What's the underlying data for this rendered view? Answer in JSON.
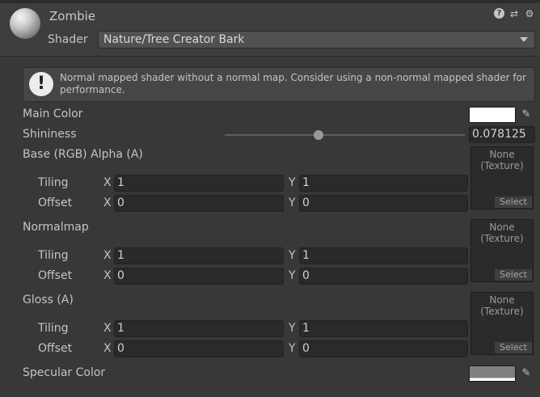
{
  "header": {
    "material_name": "Zombie",
    "shader_label": "Shader",
    "shader_value": "Nature/Tree Creator Bark",
    "icons": [
      "help-icon",
      "preset-icon",
      "settings-icon"
    ]
  },
  "warning": {
    "icon": "!",
    "text": "Normal mapped shader without a normal map. Consider using a non-normal mapped shader for performance."
  },
  "properties": {
    "main_color": {
      "label": "Main Color",
      "color": "#ffffff"
    },
    "shininess": {
      "label": "Shininess",
      "value": "0.078125",
      "fraction": 0.39
    },
    "base": {
      "label": "Base (RGB) Alpha (A)",
      "tiling_label": "Tiling",
      "offset_label": "Offset",
      "x_axis": "X",
      "y_axis": "Y",
      "tiling_x": "1",
      "tiling_y": "1",
      "offset_x": "0",
      "offset_y": "0",
      "texture_none": "None\n(Texture)",
      "select_label": "Select"
    },
    "normalmap": {
      "label": "Normalmap",
      "tiling_label": "Tiling",
      "offset_label": "Offset",
      "x_axis": "X",
      "y_axis": "Y",
      "tiling_x": "1",
      "tiling_y": "1",
      "offset_x": "0",
      "offset_y": "0",
      "texture_none": "None\n(Texture)",
      "select_label": "Select"
    },
    "gloss": {
      "label": "Gloss (A)",
      "tiling_label": "Tiling",
      "offset_label": "Offset",
      "x_axis": "X",
      "y_axis": "Y",
      "tiling_x": "1",
      "tiling_y": "1",
      "offset_x": "0",
      "offset_y": "0",
      "texture_none": "None\n(Texture)",
      "select_label": "Select"
    },
    "specular_color": {
      "label": "Specular Color",
      "color": "#808080"
    }
  }
}
